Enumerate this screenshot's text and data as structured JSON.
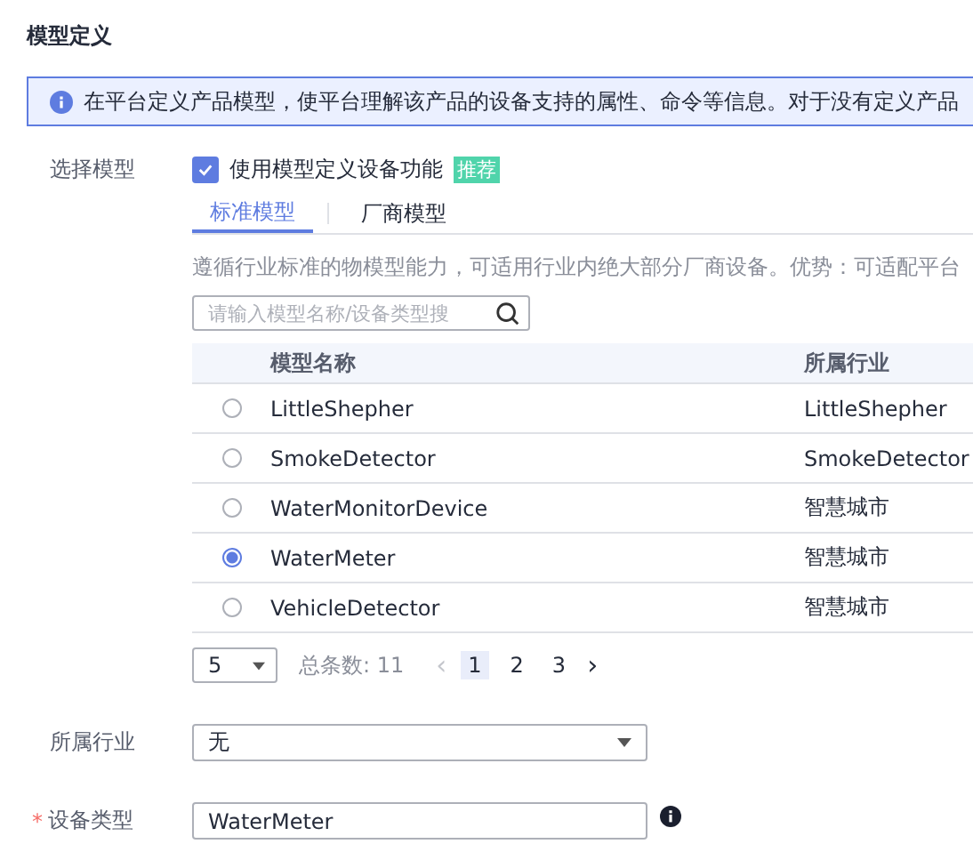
{
  "section_title": "模型定义",
  "info_banner": "在平台定义产品模型，使平台理解该产品的设备支持的属性、命令等信息。对于没有定义产品",
  "model_field": {
    "label": "选择模型",
    "checkbox": {
      "label": "使用模型定义设备功能",
      "checked": true
    },
    "badge": "推荐"
  },
  "tabs": [
    {
      "label": "标准模型",
      "selected": true
    },
    {
      "label": "厂商模型",
      "selected": false
    }
  ],
  "description": "遵循行业标准的物模型能力，可适用行业内绝大部分厂商设备。优势：可适配平台",
  "search": {
    "placeholder": "请输入模型名称/设备类型搜"
  },
  "table": {
    "columns": [
      "模型名称",
      "所属行业"
    ],
    "rows": [
      {
        "name": "LittleShepher",
        "industry": "LittleShepher",
        "selected": false
      },
      {
        "name": "SmokeDetector",
        "industry": "SmokeDetector",
        "selected": false
      },
      {
        "name": "WaterMonitorDevice",
        "industry": "智慧城市",
        "selected": false
      },
      {
        "name": "WaterMeter",
        "industry": "智慧城市",
        "selected": true
      },
      {
        "name": "VehicleDetector",
        "industry": "智慧城市",
        "selected": false
      }
    ]
  },
  "pagination": {
    "page_size": "5",
    "total": "总条数: 11",
    "prev": "‹",
    "next": "›",
    "pages": [
      {
        "label": "1",
        "selected": true
      },
      {
        "label": "2",
        "selected": false
      },
      {
        "label": "3",
        "selected": false
      }
    ]
  },
  "industry_field": {
    "label": "所属行业",
    "value": "无"
  },
  "device_type_field": {
    "label": "设备类型",
    "required_mark": "*",
    "value": "WaterMeter"
  }
}
